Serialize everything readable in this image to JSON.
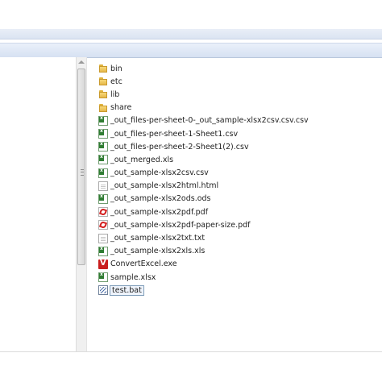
{
  "files": [
    {
      "name": "bin",
      "icon": "folder-icon"
    },
    {
      "name": "etc",
      "icon": "folder-icon"
    },
    {
      "name": "lib",
      "icon": "folder-icon"
    },
    {
      "name": "share",
      "icon": "folder-icon"
    },
    {
      "name": "_out_files-per-sheet-0-_out_sample-xlsx2csv.csv.csv",
      "icon": "excel-icon"
    },
    {
      "name": "_out_files-per-sheet-1-Sheet1.csv",
      "icon": "excel-icon"
    },
    {
      "name": "_out_files-per-sheet-2-Sheet1(2).csv",
      "icon": "excel-icon"
    },
    {
      "name": "_out_merged.xls",
      "icon": "excel-icon"
    },
    {
      "name": "_out_sample-xlsx2csv.csv",
      "icon": "excel-icon"
    },
    {
      "name": "_out_sample-xlsx2html.html",
      "icon": "document-icon"
    },
    {
      "name": "_out_sample-xlsx2ods.ods",
      "icon": "excel-icon"
    },
    {
      "name": "_out_sample-xlsx2pdf.pdf",
      "icon": "pdf-icon"
    },
    {
      "name": "_out_sample-xlsx2pdf-paper-size.pdf",
      "icon": "pdf-icon"
    },
    {
      "name": "_out_sample-xlsx2txt.txt",
      "icon": "document-icon"
    },
    {
      "name": "_out_sample-xlsx2xls.xls",
      "icon": "excel-icon"
    },
    {
      "name": "ConvertExcel.exe",
      "icon": "exe-icon"
    },
    {
      "name": "sample.xlsx",
      "icon": "excel-icon"
    },
    {
      "name": "test.bat",
      "icon": "batch-file-icon",
      "selected": true
    }
  ]
}
